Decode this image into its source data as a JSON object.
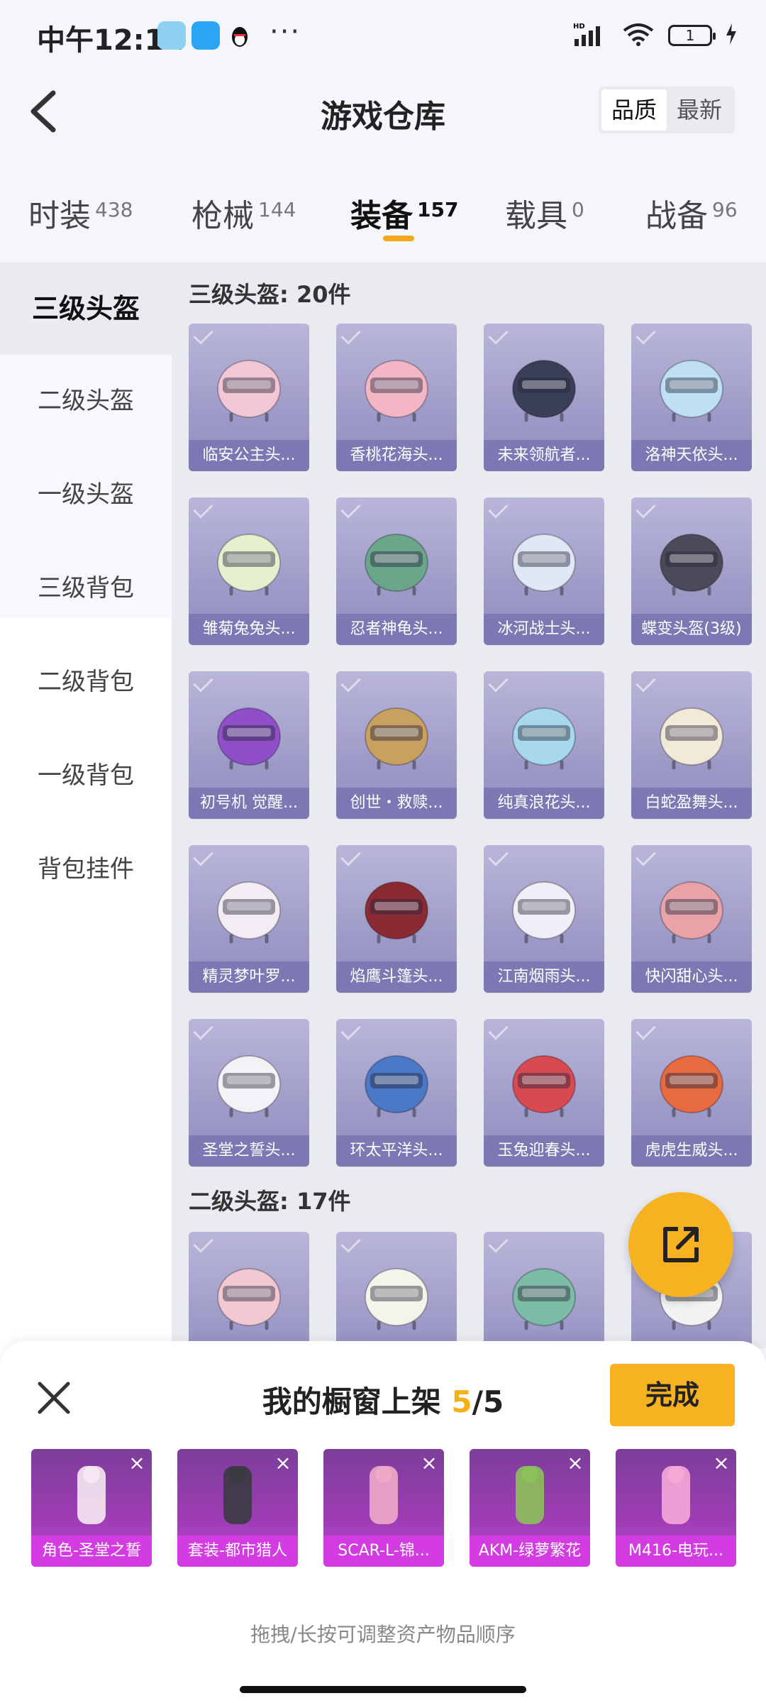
{
  "status_bar": {
    "time": "中午12:12",
    "dots": "···",
    "signal": "HD",
    "battery": "1"
  },
  "header": {
    "title": "游戏仓库",
    "sort_options": [
      "品质",
      "最新"
    ]
  },
  "tabs": [
    {
      "label": "时装",
      "count": "438"
    },
    {
      "label": "枪械",
      "count": "144"
    },
    {
      "label": "装备",
      "count": "157"
    },
    {
      "label": "载具",
      "count": "0"
    },
    {
      "label": "战备",
      "count": "96"
    }
  ],
  "sidebar": {
    "items": [
      "三级头盔",
      "二级头盔",
      "一级头盔",
      "三级背包",
      "二级背包",
      "一级背包",
      "背包挂件"
    ]
  },
  "sections": [
    {
      "title": "三级头盔: 20件",
      "items": [
        {
          "name": "临安公主头...",
          "color": "#f3c6d6"
        },
        {
          "name": "香桃花海头...",
          "color": "#f2b6c4"
        },
        {
          "name": "未来领航者...",
          "color": "#3a3f58"
        },
        {
          "name": "洛神天依头...",
          "color": "#bfe0f4"
        },
        {
          "name": "雏菊兔兔头...",
          "color": "#e6f0cf"
        },
        {
          "name": "忍者神龟头...",
          "color": "#6aa68a"
        },
        {
          "name": "冰河战士头...",
          "color": "#dfe8f4"
        },
        {
          "name": "蝶变头盔(3级)",
          "color": "#4a4a58"
        },
        {
          "name": "初号机 觉醒...",
          "color": "#8f4fc8"
        },
        {
          "name": "创世・救赎...",
          "color": "#c8a060"
        },
        {
          "name": "纯真浪花头...",
          "color": "#a8d8ec"
        },
        {
          "name": "白蛇盈舞头...",
          "color": "#f2ead8"
        },
        {
          "name": "精灵梦叶罗...",
          "color": "#f3ecf2"
        },
        {
          "name": "焰鹰斗篷头...",
          "color": "#8a2a32"
        },
        {
          "name": "江南烟雨头...",
          "color": "#f0eef6"
        },
        {
          "name": "快闪甜心头...",
          "color": "#e8a2a8"
        },
        {
          "name": "圣堂之誓头...",
          "color": "#f4f2f6"
        },
        {
          "name": "环太平洋头...",
          "color": "#4c78c8"
        },
        {
          "name": "玉兔迎春头...",
          "color": "#d84a50"
        },
        {
          "name": "虎虎生威头...",
          "color": "#e86a40"
        }
      ]
    },
    {
      "title": "二级头盔: 17件",
      "items": [
        {
          "name": "",
          "color": "#f2c8d2"
        },
        {
          "name": "",
          "color": "#f4f4ea"
        },
        {
          "name": "",
          "color": "#7cbca6"
        },
        {
          "name": "",
          "color": "#f2f2f2"
        }
      ]
    }
  ],
  "showcase": {
    "title_prefix": "我的橱窗上架",
    "current": "5",
    "separator": "/",
    "total": "5",
    "done_label": "完成",
    "items": [
      {
        "name": "角色-圣堂之誓",
        "color": "#f5e8f2"
      },
      {
        "name": "套装-都市猎人",
        "color": "#3a3a42"
      },
      {
        "name": "SCAR-L-锦...",
        "color": "#f0a8c8"
      },
      {
        "name": "AKM-绿萝繁花",
        "color": "#8cc05a"
      },
      {
        "name": "M416-电玩...",
        "color": "#f6a8d8"
      }
    ],
    "hint": "拖拽/长按可调整资产物品顺序"
  }
}
